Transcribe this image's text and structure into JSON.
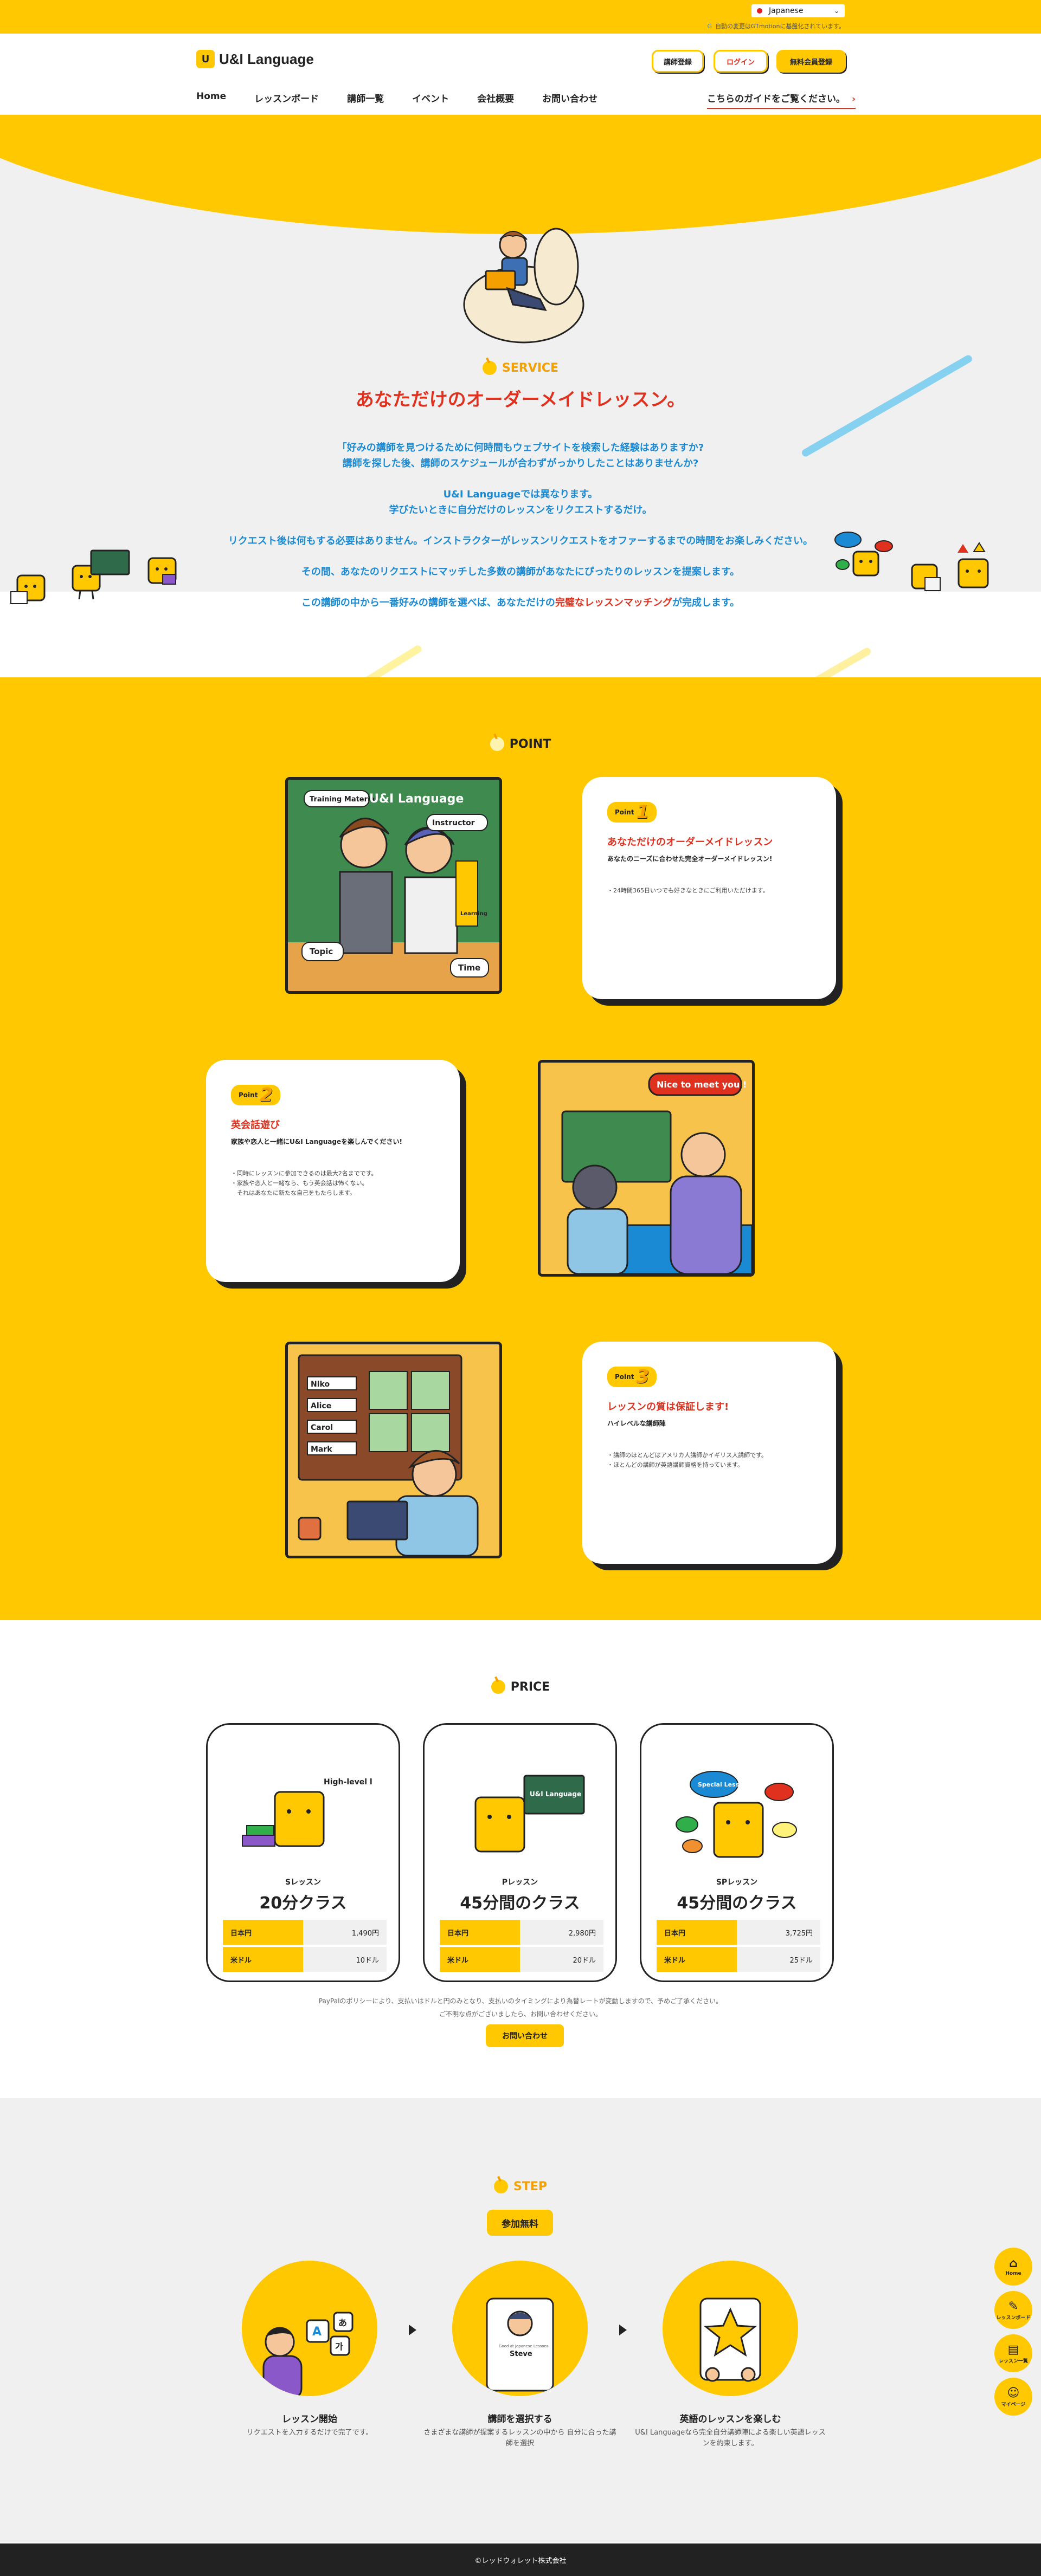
{
  "topbar": {
    "language": "Japanese",
    "note": "自動の変更はGTmotionに基盤化されています。"
  },
  "header": {
    "logo_mark": "U",
    "logo_text": "U&I Language",
    "buttons": [
      "講師登録",
      "ログイン",
      "無料会員登録"
    ],
    "nav": [
      "Home",
      "レッスンボード",
      "講師一覧",
      "イベント",
      "会社概要",
      "お問い合わせ"
    ],
    "guide": "こちらのガイドをご覧ください。",
    "guide_arrow": "›"
  },
  "service": {
    "label": "SERVICE",
    "title": "あなただけのオーダーメイドレッスン。",
    "p1_line1": "「好みの講師を見つけるために何時間もウェブサイトを検索した経験はありますか?",
    "p1_line2": "講師を探した後、講師のスケジュールが合わずがっかりしたことはありませんか?",
    "p2_line1": "U&I Languageでは異なります。",
    "p2_line2": "学びたいときに自分だけのレッスンをリクエストするだけ。",
    "p3": "リクエスト後は何もする必要はありません。インストラクターがレッスンリクエストをオファーするまでの時間をお楽しみください。",
    "p4": "その間、あなたのリクエストにマッチした多数の講師があなたにぴったりのレッスンを提案します。",
    "p5_a": "この講師の中から一番好みの講師を選べば、あなただけの",
    "p5_red": "完璧なレッスンマッチング",
    "p5_b": "が完成します。"
  },
  "point": {
    "label": "POINT",
    "badge_text": "Point",
    "cards": [
      {
        "num": "1",
        "title": "あなただけのオーダーメイドレッスン",
        "sub": "あなたのニーズに合わせた完全オーダーメイドレッスン!",
        "items": [
          "・24時間365日いつでも好きなときにご利用いただけます。"
        ]
      },
      {
        "num": "2",
        "title": "英会話遊び",
        "sub": "家族や恋人と一緒にU&I Languageを楽しんでください!",
        "items": [
          "・同時にレッスンに参加できるのは最大2名までです。",
          "・家族や恋人と一緒なら、もう英会話は怖くない。",
          "　それはあなたに新たな自己をもたらします。"
        ]
      },
      {
        "num": "3",
        "title": "レッスンの質は保証します!",
        "sub": "ハイレベルな講師陣",
        "items": [
          "・講師のほとんどはアメリカ人講師かイギリス人講師です。",
          "・ほとんどの講師が英語講師資格を持っています。"
        ]
      }
    ],
    "img1_labels": [
      "Training Material",
      "U&I Language",
      "Instructor",
      "Topic",
      "Time",
      "Learning"
    ],
    "img2_bubble": "Nice to meet you !",
    "img3_names": [
      "Niko",
      "Alice",
      "Carol",
      "Mark"
    ]
  },
  "price": {
    "label": "PRICE",
    "cards": [
      {
        "name": "Sレッスン",
        "class": "20分クラス",
        "rows": [
          [
            "日本円",
            "1,490円"
          ],
          [
            "米ドル",
            "10ドル"
          ]
        ],
        "ill_text": "High-level lesson"
      },
      {
        "name": "Pレッスン",
        "class": "45分間のクラス",
        "rows": [
          [
            "日本円",
            "2,980円"
          ],
          [
            "米ドル",
            "20ドル"
          ]
        ],
        "ill_text": "U&I Language"
      },
      {
        "name": "SPレッスン",
        "class": "45分間のクラス",
        "rows": [
          [
            "日本円",
            "3,725円"
          ],
          [
            "米ドル",
            "25ドル"
          ]
        ],
        "ill_text": "Special Lesson"
      }
    ],
    "note1": "PayPalのポリシーにより、支払いはドルと円のみとなり、支払いのタイミングにより為替レートが変動しますので、予めご了承ください。",
    "note2": "ご不明な点がございましたら、お問い合わせください。",
    "contact": "お問い合わせ"
  },
  "step": {
    "label": "STEP",
    "free": "参加無料",
    "steps": [
      {
        "title": "レッスン開始",
        "desc": "リクエストを入力するだけで完了です。"
      },
      {
        "title": "講師を選択する",
        "desc": "さまざまな講師が提案するレッスンの中から 自分に合った講師を選択"
      },
      {
        "title": "英語のレッスンを楽しむ",
        "desc": "U&I Languageなら完全自分講師陣による楽しい英語レッスンを約束します。"
      }
    ],
    "card_caption": "Good at Japanese Lessons",
    "card_name": "Steve"
  },
  "side": [
    {
      "icon": "⌂",
      "label": "Home"
    },
    {
      "icon": "✎",
      "label": "レッスンボード"
    },
    {
      "icon": "▤",
      "label": "レッスン一覧"
    },
    {
      "icon": "☺",
      "label": "マイページ"
    }
  ],
  "footer": "©レッドウォレット株式会社",
  "colors": {
    "accent": "#ffc800",
    "red": "#e0301e",
    "blue": "#1a8ad4"
  }
}
